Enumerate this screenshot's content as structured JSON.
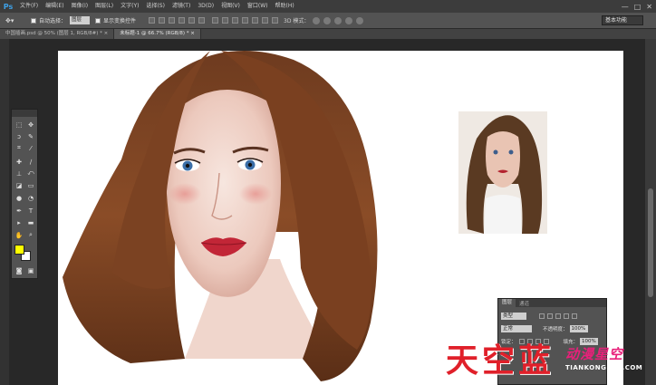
{
  "app": {
    "logo": "Ps",
    "menu": [
      "文件(F)",
      "编辑(E)",
      "图像(I)",
      "图层(L)",
      "文字(Y)",
      "选择(S)",
      "滤镜(T)",
      "3D(D)",
      "视图(V)",
      "窗口(W)",
      "帮助(H)"
    ],
    "window_controls": [
      "—",
      "□",
      "✕"
    ]
  },
  "options_bar": {
    "tool_icon": "move-tool-icon",
    "auto_select_label": "自动选择：",
    "auto_select_value": "图层",
    "show_transform_label": "显示变换控件",
    "mode_3d_label": "3D 模式：",
    "workspace": "基本功能"
  },
  "tabs": [
    {
      "label": "中国插画.psd @ 50% (图层 1, RGB/8#) *  ×",
      "active": false
    },
    {
      "label": "未标题-1 @ 66.7% (RGB/8) *  ×",
      "active": true
    }
  ],
  "toolbox": {
    "tools": [
      {
        "name": "move-tool-icon",
        "glyph": "✥"
      },
      {
        "name": "marquee-tool-icon",
        "glyph": "⬚"
      },
      {
        "name": "lasso-tool-icon",
        "glyph": "ↄ"
      },
      {
        "name": "quick-select-tool-icon",
        "glyph": "✎"
      },
      {
        "name": "crop-tool-icon",
        "glyph": "⌗"
      },
      {
        "name": "eyedropper-tool-icon",
        "glyph": "⁄"
      },
      {
        "name": "healing-brush-tool-icon",
        "glyph": "✚"
      },
      {
        "name": "brush-tool-icon",
        "glyph": "∕"
      },
      {
        "name": "clone-stamp-tool-icon",
        "glyph": "⊥"
      },
      {
        "name": "history-brush-tool-icon",
        "glyph": "⤺"
      },
      {
        "name": "eraser-tool-icon",
        "glyph": "◪"
      },
      {
        "name": "gradient-tool-icon",
        "glyph": "▭"
      },
      {
        "name": "blur-tool-icon",
        "glyph": "●"
      },
      {
        "name": "dodge-tool-icon",
        "glyph": "◔"
      },
      {
        "name": "pen-tool-icon",
        "glyph": "✒"
      },
      {
        "name": "type-tool-icon",
        "glyph": "T"
      },
      {
        "name": "path-select-tool-icon",
        "glyph": "▸"
      },
      {
        "name": "shape-tool-icon",
        "glyph": "▬"
      },
      {
        "name": "hand-tool-icon",
        "glyph": "✋"
      },
      {
        "name": "zoom-tool-icon",
        "glyph": "⌕"
      }
    ],
    "foreground_color": "#ffff00",
    "background_color": "#ffffff"
  },
  "layers_panel": {
    "tabs": [
      "图层",
      "通道"
    ],
    "filter": "类型",
    "blend_mode": "正常",
    "opacity_label": "不透明度：",
    "opacity_value": "100%",
    "lock_label": "锁定：",
    "fill_label": "填充：",
    "fill_value": "100%"
  },
  "watermark": {
    "text": [
      "天",
      "空",
      "蓝"
    ],
    "subtitle": "动漫星空",
    "url": "TIANKONGLAN.COM"
  },
  "colors": {
    "menu_bg": "#3c3c3c",
    "options_bg": "#535353",
    "canvas_bg": "#282828",
    "accent": "#3ea0e6",
    "watermark_red": "#e0202a"
  }
}
